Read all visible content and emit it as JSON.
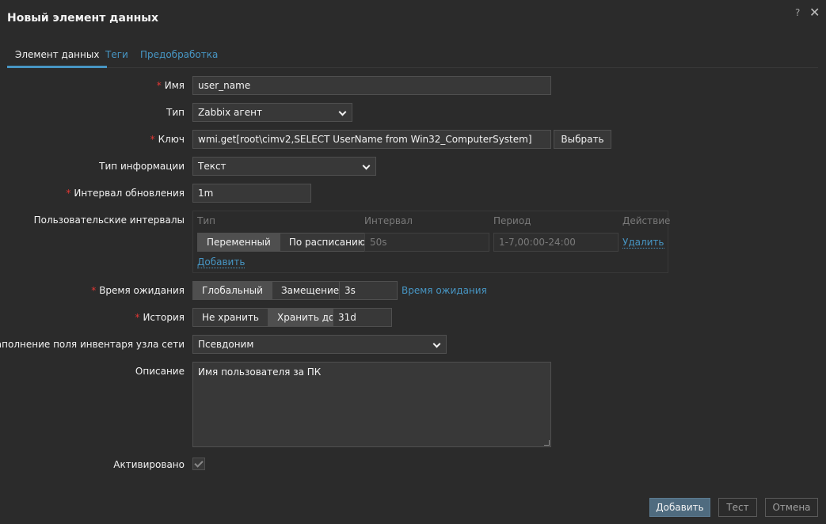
{
  "dialog": {
    "title": "Новый элемент данных",
    "help": "?",
    "close": "✕"
  },
  "tabs": [
    {
      "label": "Элемент данных"
    },
    {
      "label": "Теги"
    },
    {
      "label": "Предобработка"
    }
  ],
  "form": {
    "name": {
      "label": "Имя",
      "value": "user_name",
      "required": "*"
    },
    "type": {
      "label": "Тип",
      "value": "Zabbix агент"
    },
    "key": {
      "label": "Ключ",
      "value": "wmi.get[root\\cimv2,SELECT UserName from Win32_ComputerSystem]",
      "button": "Выбрать",
      "required": "*"
    },
    "info_type": {
      "label": "Тип информации",
      "value": "Текст"
    },
    "update_interval": {
      "label": "Интервал обновления",
      "value": "1m",
      "required": "*"
    },
    "custom_intervals": {
      "label": "Пользовательские интервалы",
      "headers": {
        "type": "Тип",
        "interval": "Интервал",
        "period": "Период",
        "action": "Действие"
      },
      "type_options": [
        "Переменный",
        "По расписанию"
      ],
      "interval_value": "50s",
      "period_value": "1-7,00:00-24:00",
      "remove": "Удалить",
      "add": "Добавить"
    },
    "timeout": {
      "label": "Время ожидания",
      "options": [
        "Глобальный",
        "Замещение"
      ],
      "value": "3s",
      "link": "Время ожидания",
      "required": "*"
    },
    "history": {
      "label": "История",
      "options": [
        "Не хранить",
        "Хранить до"
      ],
      "value": "31d",
      "required": "*"
    },
    "inventory": {
      "label": "Заполнение поля инвентаря узла сети",
      "value": "Псевдоним"
    },
    "description": {
      "label": "Описание",
      "value": "Имя пользователя за ПК"
    },
    "enabled": {
      "label": "Активировано"
    }
  },
  "footer": {
    "add": "Добавить",
    "test": "Тест",
    "cancel": "Отмена"
  }
}
